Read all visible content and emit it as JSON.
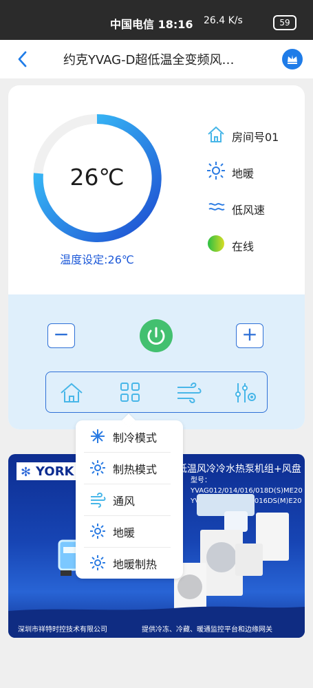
{
  "status_bar": {
    "carrier_time": "中国电信 18:16",
    "network_speed": "26.4 K/s",
    "battery": "59"
  },
  "header": {
    "back_icon": "back-arrow-icon",
    "title": "约克YVAG-D超低温全变频风…",
    "crown_icon": "crown-icon"
  },
  "device": {
    "temperature": "26℃",
    "setpoint": "温度设定:26℃",
    "info": [
      {
        "icon": "home-icon",
        "label": "房间号01"
      },
      {
        "icon": "sun-icon",
        "label": "地暖"
      },
      {
        "icon": "wind-icon",
        "label": "低风速"
      },
      {
        "icon": "online-dot-icon",
        "label": "在线"
      }
    ],
    "controls": {
      "minus": "−",
      "plus": "+"
    },
    "control_icons": [
      "home-icon",
      "grid-icon",
      "wind-icon",
      "settings-icon"
    ]
  },
  "mode_menu": {
    "items": [
      "制冷模式",
      "制热模式",
      "通风",
      "地暖",
      "地暖制热"
    ]
  },
  "banner": {
    "logo": "YORK",
    "title_part": "低温风冷冷水热泵机组+风盘",
    "model_line1": "型号： YVAG012/014/016/018D(S)ME20",
    "model_line2": "YVAS010/012/014/016DS(M)E20",
    "company": "深圳市祥特时控技术有限公司",
    "slogan": "提供冷冻、冷藏、暖通监控平台和边缘网关"
  },
  "colors": {
    "accent_blue": "#1d59d8",
    "power_green": "#43c06f",
    "gauge_gradient_start": "#3ed3ff",
    "gauge_gradient_end": "#1d4bd0"
  }
}
